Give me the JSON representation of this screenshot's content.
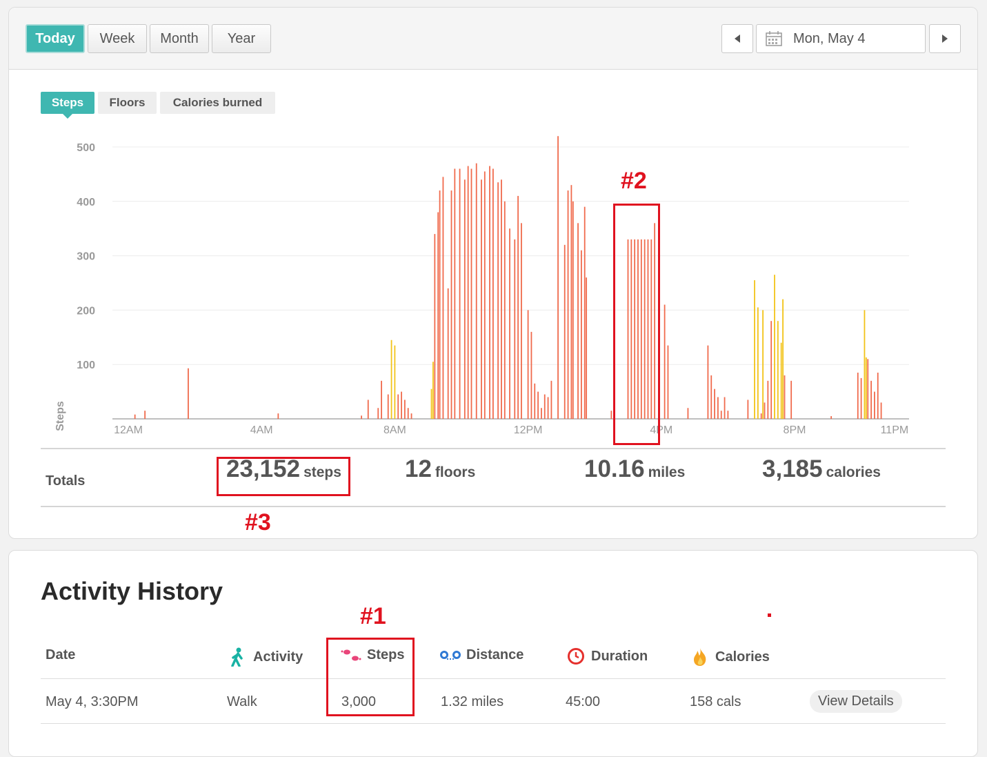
{
  "range_buttons": [
    "Today",
    "Week",
    "Month",
    "Year"
  ],
  "date_label": "Mon, May 4",
  "chart_tabs": [
    "Steps",
    "Floors",
    "Calories burned"
  ],
  "colors": {
    "accent": "#3fb7b1",
    "bar_active": "#f06a4c",
    "bar_light": "#f2c318",
    "annotation": "#e0121f"
  },
  "chart_data": {
    "type": "bar",
    "ylabel": "Steps",
    "ylim": [
      0,
      500
    ],
    "y_ticks": [
      100,
      200,
      300,
      400,
      500
    ],
    "x_tick_labels": [
      "12AM",
      "4AM",
      "8AM",
      "12PM",
      "4PM",
      "8PM",
      "11PM"
    ],
    "x_unit": "hour of day",
    "series": [
      {
        "name": "",
        "color": "#f06a4c",
        "points": [
          [
            0.2,
            8
          ],
          [
            0.5,
            15
          ],
          [
            1.8,
            93
          ],
          [
            4.5,
            10
          ],
          [
            7.0,
            6
          ],
          [
            7.2,
            35
          ],
          [
            7.5,
            20
          ],
          [
            7.6,
            70
          ],
          [
            7.8,
            45
          ],
          [
            8.1,
            45
          ],
          [
            8.2,
            50
          ],
          [
            8.3,
            35
          ],
          [
            8.4,
            20
          ],
          [
            8.5,
            10
          ],
          [
            9.2,
            340
          ],
          [
            9.3,
            380
          ],
          [
            9.35,
            420
          ],
          [
            9.45,
            445
          ],
          [
            9.6,
            240
          ],
          [
            9.7,
            420
          ],
          [
            9.8,
            460
          ],
          [
            9.95,
            460
          ],
          [
            10.1,
            440
          ],
          [
            10.2,
            465
          ],
          [
            10.3,
            460
          ],
          [
            10.45,
            470
          ],
          [
            10.6,
            440
          ],
          [
            10.7,
            455
          ],
          [
            10.85,
            465
          ],
          [
            10.95,
            460
          ],
          [
            11.1,
            435
          ],
          [
            11.2,
            440
          ],
          [
            11.3,
            400
          ],
          [
            11.45,
            350
          ],
          [
            11.6,
            330
          ],
          [
            11.7,
            410
          ],
          [
            11.8,
            360
          ],
          [
            12.0,
            200
          ],
          [
            12.1,
            160
          ],
          [
            12.2,
            65
          ],
          [
            12.3,
            50
          ],
          [
            12.4,
            20
          ],
          [
            12.5,
            45
          ],
          [
            12.6,
            40
          ],
          [
            12.7,
            70
          ],
          [
            12.9,
            520
          ],
          [
            13.1,
            320
          ],
          [
            13.2,
            420
          ],
          [
            13.3,
            430
          ],
          [
            13.35,
            400
          ],
          [
            13.5,
            360
          ],
          [
            13.6,
            310
          ],
          [
            13.7,
            390
          ],
          [
            13.75,
            260
          ],
          [
            14.5,
            15
          ],
          [
            15.0,
            330
          ],
          [
            15.1,
            330
          ],
          [
            15.2,
            330
          ],
          [
            15.3,
            330
          ],
          [
            15.4,
            330
          ],
          [
            15.5,
            330
          ],
          [
            15.6,
            330
          ],
          [
            15.7,
            330
          ],
          [
            15.8,
            360
          ],
          [
            16.1,
            210
          ],
          [
            16.2,
            135
          ],
          [
            16.8,
            20
          ],
          [
            17.4,
            135
          ],
          [
            17.5,
            80
          ],
          [
            17.6,
            55
          ],
          [
            17.7,
            40
          ],
          [
            17.8,
            15
          ],
          [
            17.9,
            40
          ],
          [
            18.0,
            15
          ],
          [
            18.6,
            35
          ],
          [
            19.0,
            10
          ],
          [
            19.1,
            30
          ],
          [
            19.2,
            70
          ],
          [
            19.3,
            180
          ],
          [
            19.7,
            80
          ],
          [
            19.9,
            70
          ],
          [
            21.1,
            5
          ],
          [
            21.9,
            85
          ],
          [
            22.0,
            75
          ],
          [
            22.2,
            110
          ],
          [
            22.3,
            70
          ],
          [
            22.4,
            50
          ],
          [
            22.5,
            85
          ],
          [
            22.6,
            30
          ]
        ]
      },
      {
        "name": "",
        "color": "#f2c318",
        "points": [
          [
            7.9,
            145
          ],
          [
            8.0,
            135
          ],
          [
            9.1,
            55
          ],
          [
            9.15,
            105
          ],
          [
            18.8,
            255
          ],
          [
            18.9,
            205
          ],
          [
            19.05,
            200
          ],
          [
            19.4,
            265
          ],
          [
            19.5,
            180
          ],
          [
            19.6,
            140
          ],
          [
            19.65,
            220
          ],
          [
            22.1,
            200
          ],
          [
            22.15,
            113
          ]
        ]
      }
    ]
  },
  "totals": {
    "label": "Totals",
    "steps": {
      "value": "23,152",
      "unit": "steps"
    },
    "floors": {
      "value": "12",
      "unit": "floors"
    },
    "distance": {
      "value": "10.16",
      "unit": "miles"
    },
    "calories": {
      "value": "3,185",
      "unit": "calories"
    }
  },
  "activity_history": {
    "title": "Activity History",
    "columns": [
      "Date",
      "Activity",
      "Steps",
      "Distance",
      "Duration",
      "Calories"
    ],
    "rows": [
      {
        "date": "May 4, 3:30PM",
        "activity": "Walk",
        "steps": "3,000",
        "distance": "1.32 miles",
        "duration": "45:00",
        "calories": "158 cals",
        "action": "View Details"
      }
    ]
  },
  "annotations": [
    "#1",
    "#2",
    "#3"
  ]
}
